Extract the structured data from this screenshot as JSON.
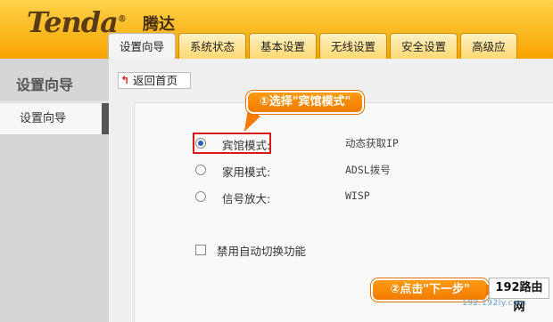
{
  "brand": {
    "logo": "Tenda",
    "logo_mark": "®",
    "name_cn": "腾达"
  },
  "tabs": [
    {
      "label": "设置向导",
      "active": true
    },
    {
      "label": "系统状态"
    },
    {
      "label": "基本设置"
    },
    {
      "label": "无线设置"
    },
    {
      "label": "安全设置"
    },
    {
      "label": "高级应"
    }
  ],
  "sidebar": {
    "title": "设置向导",
    "items": [
      {
        "label": "设置向导",
        "active": true
      }
    ]
  },
  "main": {
    "back_label": "返回首页",
    "modes": [
      {
        "label": "宾馆模式:",
        "value": "动态获取IP",
        "checked": true
      },
      {
        "label": "家用模式:",
        "value": "ADSL拨号",
        "checked": false
      },
      {
        "label": "信号放大:",
        "value": "WISP",
        "checked": false
      }
    ],
    "disable_auto_switch": {
      "label": "禁用自动切换功能",
      "checked": false
    }
  },
  "annotations": {
    "step1": "①选择\"宾馆模式\"",
    "step2": "②点击\"下一步\""
  },
  "watermark": {
    "text": "192路由网",
    "sub": "192.192ly.com"
  },
  "colors": {
    "header_top": "#ffd24a",
    "header_bottom": "#f6a400",
    "callout": "#f27b00",
    "highlight": "#d61a1a",
    "radio_dot": "#2a5fb8"
  }
}
